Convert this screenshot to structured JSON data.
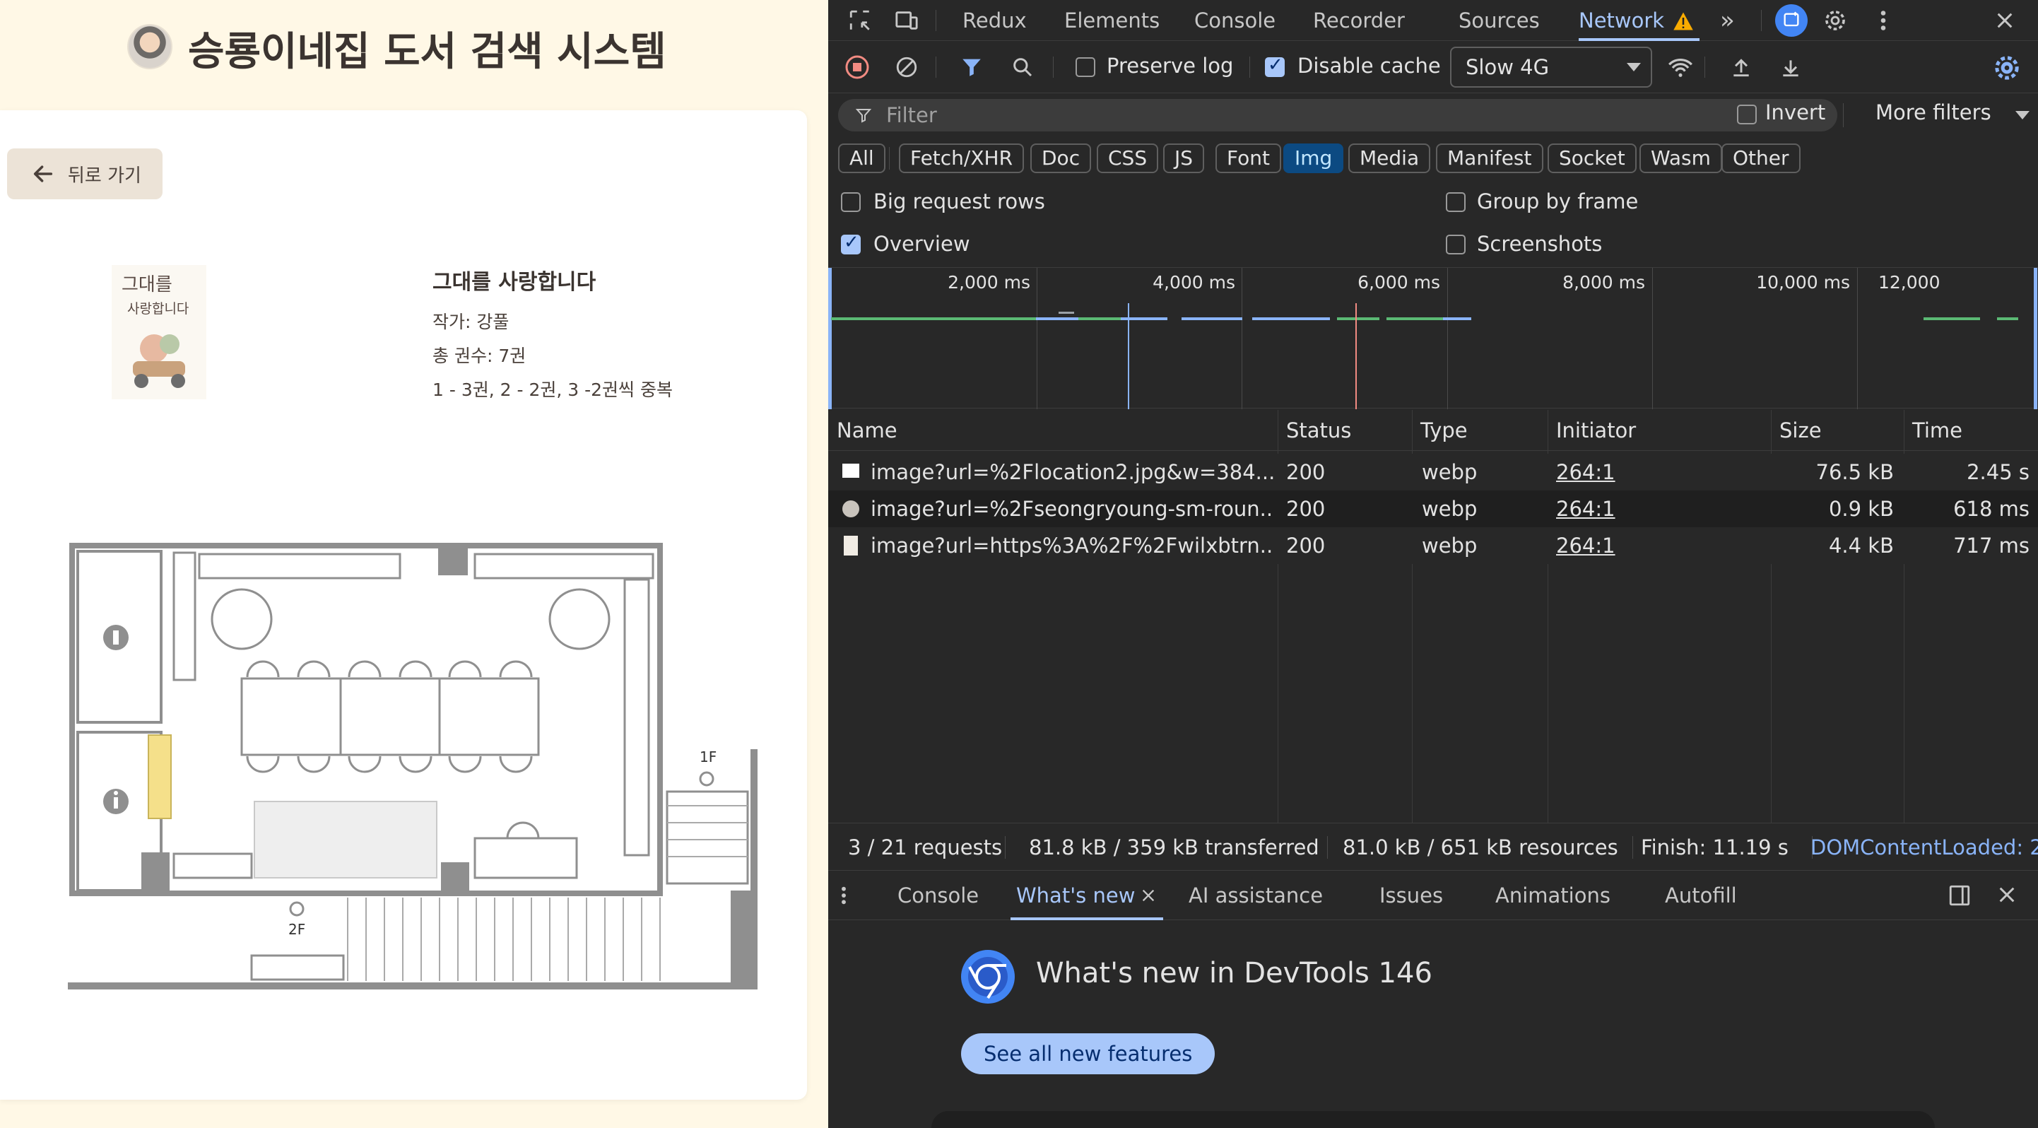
{
  "app": {
    "title": "승룡이네집 도서 검색 시스템",
    "back_label": "뒤로 가기",
    "book": {
      "title": "그대를 사랑합니다",
      "author": "작가: 강풀",
      "total": "총 권수: 7권",
      "copies": "1 - 3권, 2 - 2권, 3 -2권씩 중복",
      "cover_text_1": "그대를",
      "cover_text_2": "사랑합니다"
    },
    "map": {
      "label_1f": "1F",
      "label_2f": "2F"
    }
  },
  "devtools": {
    "tabs": [
      "Redux",
      "Elements",
      "Console",
      "Recorder",
      "Sources",
      "Network"
    ],
    "active_tab": "Network",
    "more_tabs": "»",
    "toolbar": {
      "preserve_log": "Preserve log",
      "preserve_log_checked": false,
      "disable_cache": "Disable cache",
      "disable_cache_checked": true,
      "throttle": "Slow 4G"
    },
    "filter": {
      "placeholder": "Filter",
      "invert": "Invert",
      "more_filters": "More filters"
    },
    "type_filters": [
      "All",
      "Fetch/XHR",
      "Doc",
      "CSS",
      "JS",
      "Font",
      "Img",
      "Media",
      "Manifest",
      "Socket",
      "Wasm",
      "Other"
    ],
    "active_type": "Img",
    "options": {
      "big_request_rows": "Big request rows",
      "group_by_frame": "Group by frame",
      "overview": "Overview",
      "screenshots": "Screenshots"
    },
    "overview_ticks": [
      "2,000 ms",
      "4,000 ms",
      "6,000 ms",
      "8,000 ms",
      "10,000 ms",
      "12,000"
    ],
    "columns": [
      "Name",
      "Status",
      "Type",
      "Initiator",
      "Size",
      "Time"
    ],
    "requests": [
      {
        "name": "image?url=%2Flocation2.jpg&w=384...",
        "status": "200",
        "type": "webp",
        "initiator": "264:1",
        "size": "76.5 kB",
        "time": "2.45 s"
      },
      {
        "name": "image?url=%2Fseongryoung-sm-roun...",
        "status": "200",
        "type": "webp",
        "initiator": "264:1",
        "size": "0.9 kB",
        "time": "618 ms"
      },
      {
        "name": "image?url=https%3A%2F%2Fwilxbtrn...",
        "status": "200",
        "type": "webp",
        "initiator": "264:1",
        "size": "4.4 kB",
        "time": "717 ms"
      }
    ],
    "status_bar": {
      "requests": "3 / 21 requests",
      "transferred": "81.8 kB / 359 kB transferred",
      "resources": "81.0 kB / 651 kB resources",
      "finish": "Finish: 11.19 s",
      "dcl": "DOMContentLoaded: 2"
    },
    "drawer": {
      "tabs": [
        "Console",
        "What's new",
        "AI assistance",
        "Issues",
        "Animations",
        "Autofill"
      ],
      "active": "What's new",
      "heading": "What's new in DevTools 146",
      "button": "See all new features"
    }
  },
  "colors": {
    "app_bg": "#fff8e6",
    "accent": "#a8c7fa",
    "devtools_bg": "#282828"
  }
}
